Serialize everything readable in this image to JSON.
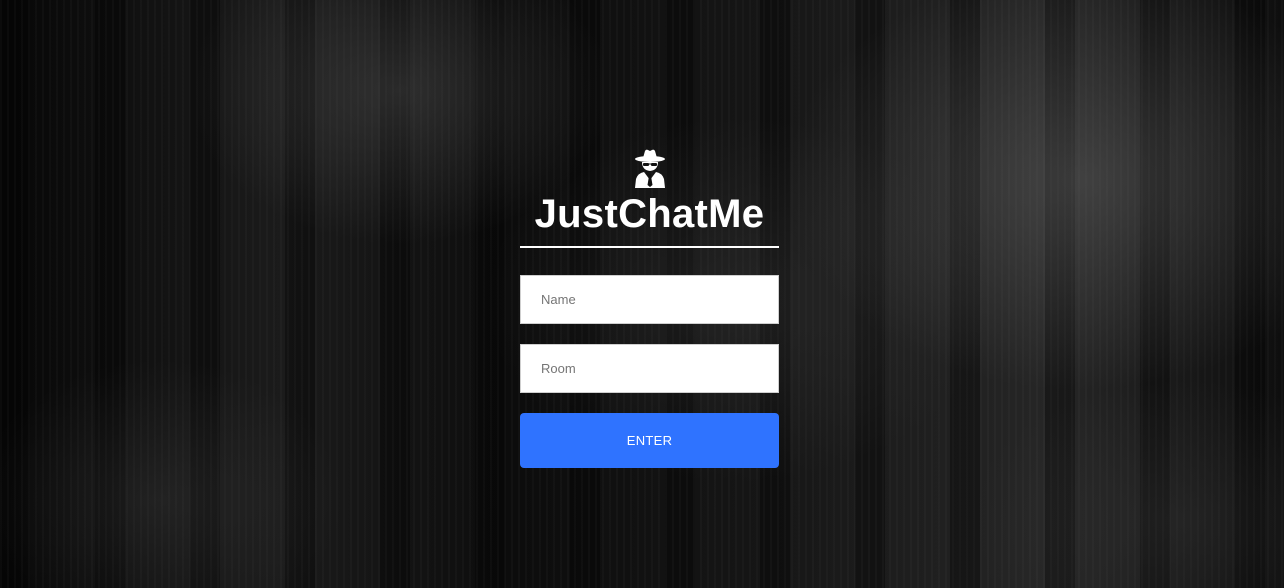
{
  "app": {
    "title": "JustChatMe",
    "logo_icon": "user-secret-icon"
  },
  "form": {
    "name_placeholder": "Name",
    "name_value": "",
    "room_placeholder": "Room",
    "room_value": "",
    "enter_label": "ENTER"
  },
  "colors": {
    "accent": "#2f73ff",
    "title": "#ffffff",
    "background": "#0a0a0a"
  }
}
